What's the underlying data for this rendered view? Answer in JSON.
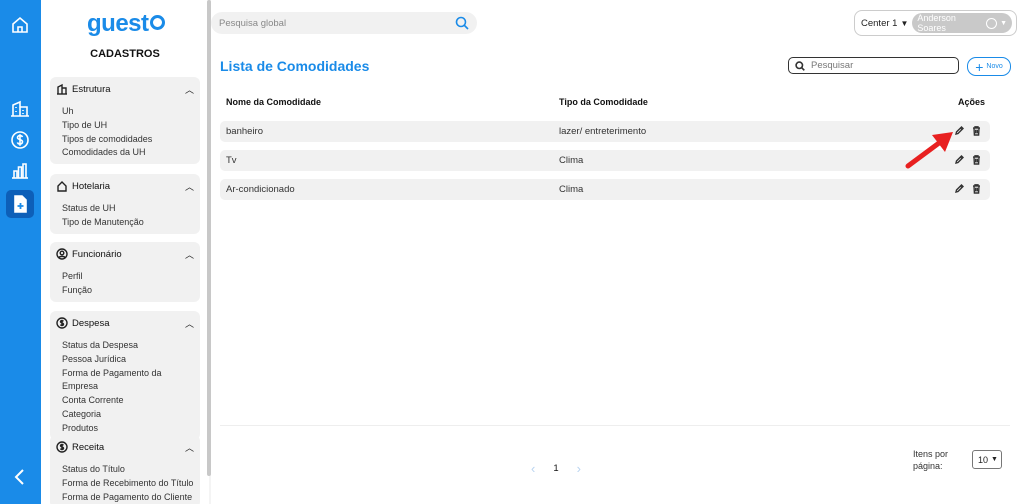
{
  "brand": {
    "logo_text": "guest",
    "accent": "#1a8be8"
  },
  "rail": {
    "icons": [
      "home-icon",
      "building-icon",
      "dollar-icon",
      "chart-icon",
      "add-file-icon",
      "chevron-left-icon"
    ]
  },
  "sidebar": {
    "title": "CADASTROS",
    "groups": [
      {
        "title": "Estrutura",
        "icon": "building-icon",
        "items": [
          "Uh",
          "Tipo de UH",
          "Tipos de comodidades",
          "Comodidades da UH"
        ]
      },
      {
        "title": "Hotelaria",
        "icon": "home-icon",
        "items": [
          "Status de UH",
          "Tipo de Manutenção"
        ]
      },
      {
        "title": "Funcionário",
        "icon": "user-icon",
        "items": [
          "Perfil",
          "Função"
        ]
      },
      {
        "title": "Despesa",
        "icon": "dollar-icon",
        "items": [
          "Status da Despesa",
          "Pessoa Jurídica",
          "Forma de Pagamento da Empresa",
          "Conta Corrente",
          "Categoria",
          "Produtos"
        ]
      },
      {
        "title": "Receita",
        "icon": "dollar-icon",
        "items": [
          "Status do Título",
          "Forma de Recebimento do Título",
          "Forma de Pagamento do Cliente"
        ]
      }
    ]
  },
  "topbar": {
    "search_placeholder": "Pesquisa global",
    "center": "Center 1",
    "user": "Anderson Soares"
  },
  "main": {
    "title": "Lista de Comodidades",
    "search_placeholder": "Pesquisar",
    "new_label": "Novo",
    "columns": [
      "Nome da Comodidade",
      "Tipo da Comodidade",
      "Ações"
    ],
    "rows": [
      {
        "name": "banheiro",
        "type": "lazer/ entreterimento"
      },
      {
        "name": "Tv",
        "type": "Clima"
      },
      {
        "name": "Ar-condicionado",
        "type": "Clima"
      }
    ],
    "pagination": {
      "page": "1",
      "per_page_label": "Itens por página:",
      "per_page": "10"
    }
  }
}
